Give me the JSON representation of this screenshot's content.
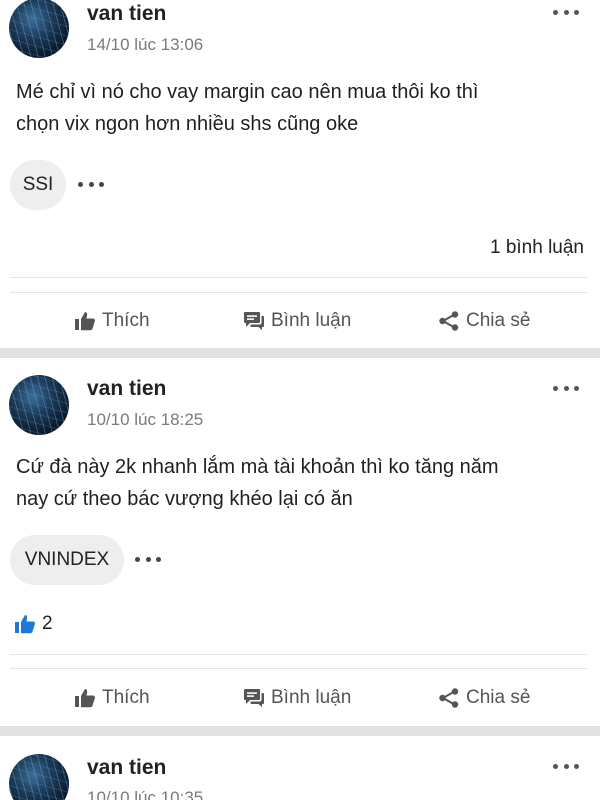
{
  "posts": [
    {
      "author": "van tien",
      "time": "14/10 lúc 13:06",
      "content_lines": [
        "Mé chỉ vì nó cho vay margin cao nên mua thôi ko thì",
        "chọn vix ngon hơn nhiều shs cũng oke"
      ],
      "tag": "SSI",
      "comments_label": "1 bình luận",
      "actions": {
        "like": "Thích",
        "comment": "Bình luận",
        "share": "Chia sẻ"
      }
    },
    {
      "author": "van tien",
      "time": "10/10 lúc 18:25",
      "content_lines": [
        "Cứ đà này 2k nhanh lắm mà tài khoản thì ko tăng năm",
        "nay cứ theo bác vượng khéo lại có ăn"
      ],
      "tag": "VNINDEX",
      "likes_count": "2",
      "actions": {
        "like": "Thích",
        "comment": "Bình luận",
        "share": "Chia sẻ"
      }
    },
    {
      "author": "van tien",
      "time": "10/10 lúc 10:35"
    }
  ],
  "icons": {
    "like": "thumbs-up-icon",
    "comment": "comment-icon",
    "share": "share-icon",
    "more": "more-dots-icon"
  },
  "colors": {
    "like_accent": "#1e78d6",
    "separator": "#e1e1e1",
    "tag_bg": "#eeeeee"
  }
}
